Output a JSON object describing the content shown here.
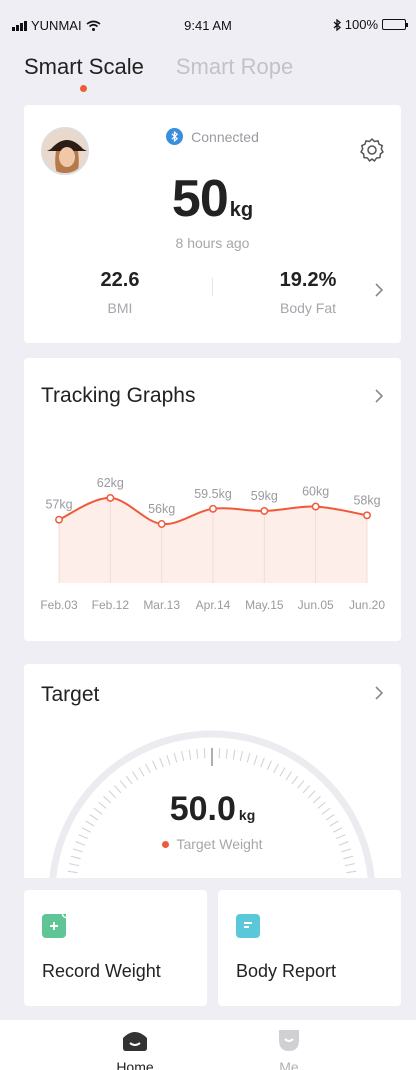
{
  "status_bar": {
    "carrier": "YUNMAI",
    "time": "9:41 AM",
    "battery": "100%",
    "icons": [
      "signal-icon",
      "wifi-icon",
      "bluetooth-icon",
      "battery-icon"
    ]
  },
  "tabs": [
    {
      "label": "Smart Scale",
      "active": true
    },
    {
      "label": "Smart Rope",
      "active": false
    }
  ],
  "profile": {
    "connection_status": "Connected",
    "weight_value": "50",
    "weight_unit": "kg",
    "measured_ago": "8 hours ago",
    "bmi_value": "22.6",
    "bmi_label": "BMI",
    "body_fat_value": "19.2%",
    "body_fat_label": "Body Fat"
  },
  "tracking": {
    "title": "Tracking Graphs",
    "chart_data": {
      "type": "line",
      "categories": [
        "Feb.03",
        "Feb.12",
        "Mar.13",
        "Apr.14",
        "May.15",
        "Jun.05",
        "Jun.20"
      ],
      "values": [
        57,
        62,
        56,
        59.5,
        59,
        60,
        58
      ],
      "point_labels": [
        "57kg",
        "62kg",
        "56kg",
        "59.5kg",
        "59kg",
        "60kg",
        "58kg"
      ],
      "unit": "kg",
      "line_color": "#f05a3a",
      "area_color": "#fdeee9"
    }
  },
  "target": {
    "title": "Target",
    "value": "50.0",
    "unit": "kg",
    "label": "Target Weight"
  },
  "tiles": {
    "record_weight": "Record Weight",
    "body_report": "Body Report"
  },
  "nav": {
    "home": "Home",
    "me": "Me"
  },
  "colors": {
    "accent": "#f05a3a",
    "record_icon": "#5fc594",
    "report_icon": "#5ac8d8",
    "bluetooth": "#3a8fdc"
  }
}
